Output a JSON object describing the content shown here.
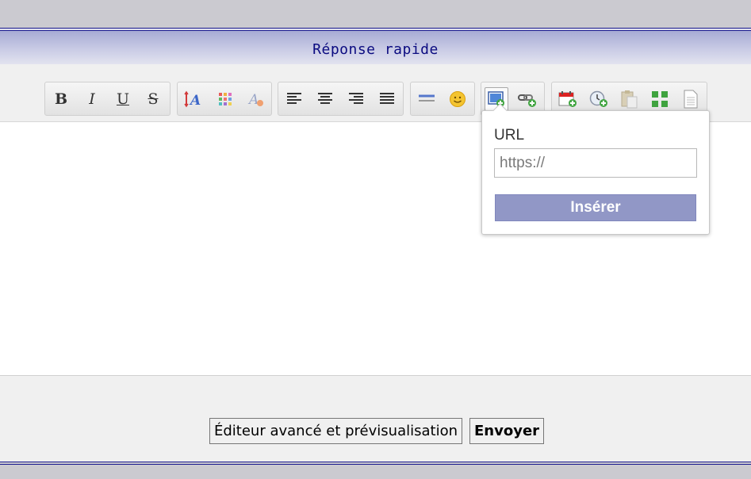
{
  "header": {
    "title": "Réponse rapide"
  },
  "toolbar": {
    "bold_label": "B",
    "italic_label": "I",
    "underline_label": "U",
    "strike_label": "S",
    "icons": [
      "bold-icon",
      "italic-icon",
      "underline-icon",
      "strikethrough-icon",
      "font-color-icon",
      "color-palette-icon",
      "clear-format-icon",
      "align-left-icon",
      "align-center-icon",
      "align-right-icon",
      "justify-icon",
      "horizontal-rule-icon",
      "emoticon-icon",
      "insert-image-icon",
      "insert-link-icon",
      "calendar-icon",
      "clock-icon",
      "paste-icon",
      "spoiler-icon",
      "document-icon"
    ]
  },
  "popup": {
    "url_label": "URL",
    "url_placeholder": "https://",
    "insert_label": "Insérer"
  },
  "footer": {
    "advanced_label": "Éditeur avancé et prévisualisation",
    "send_label": "Envoyer"
  },
  "colors": {
    "header_text": "#0b0b80",
    "border_accent": "#1b1b8f",
    "insert_button": "#9197c6"
  }
}
